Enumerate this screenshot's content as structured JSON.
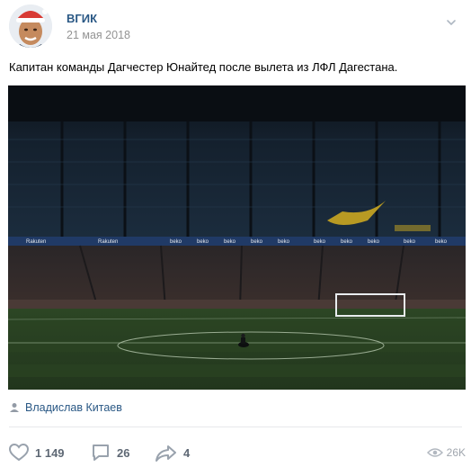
{
  "post": {
    "author": "ВГИК",
    "date": "21 мая 2018",
    "text": "Капитан команды Дагчестер Юнайтед после вылета из ЛФЛ Дагестана.",
    "photo_signature": "Владислав Китаев"
  },
  "stats": {
    "likes": "1 149",
    "comments": "26",
    "shares": "4",
    "views": "26K"
  },
  "colors": {
    "link": "#2a5885",
    "secondary": "#939393",
    "action": "#5e6874",
    "views": "#a0a6ae",
    "pitch": "#2f4b27",
    "stands": "#1a2633"
  },
  "icons": {
    "more": "chevron-down-icon",
    "signature": "person-icon",
    "like": "heart-icon",
    "comment": "comment-icon",
    "share": "share-icon",
    "views": "eye-icon"
  }
}
